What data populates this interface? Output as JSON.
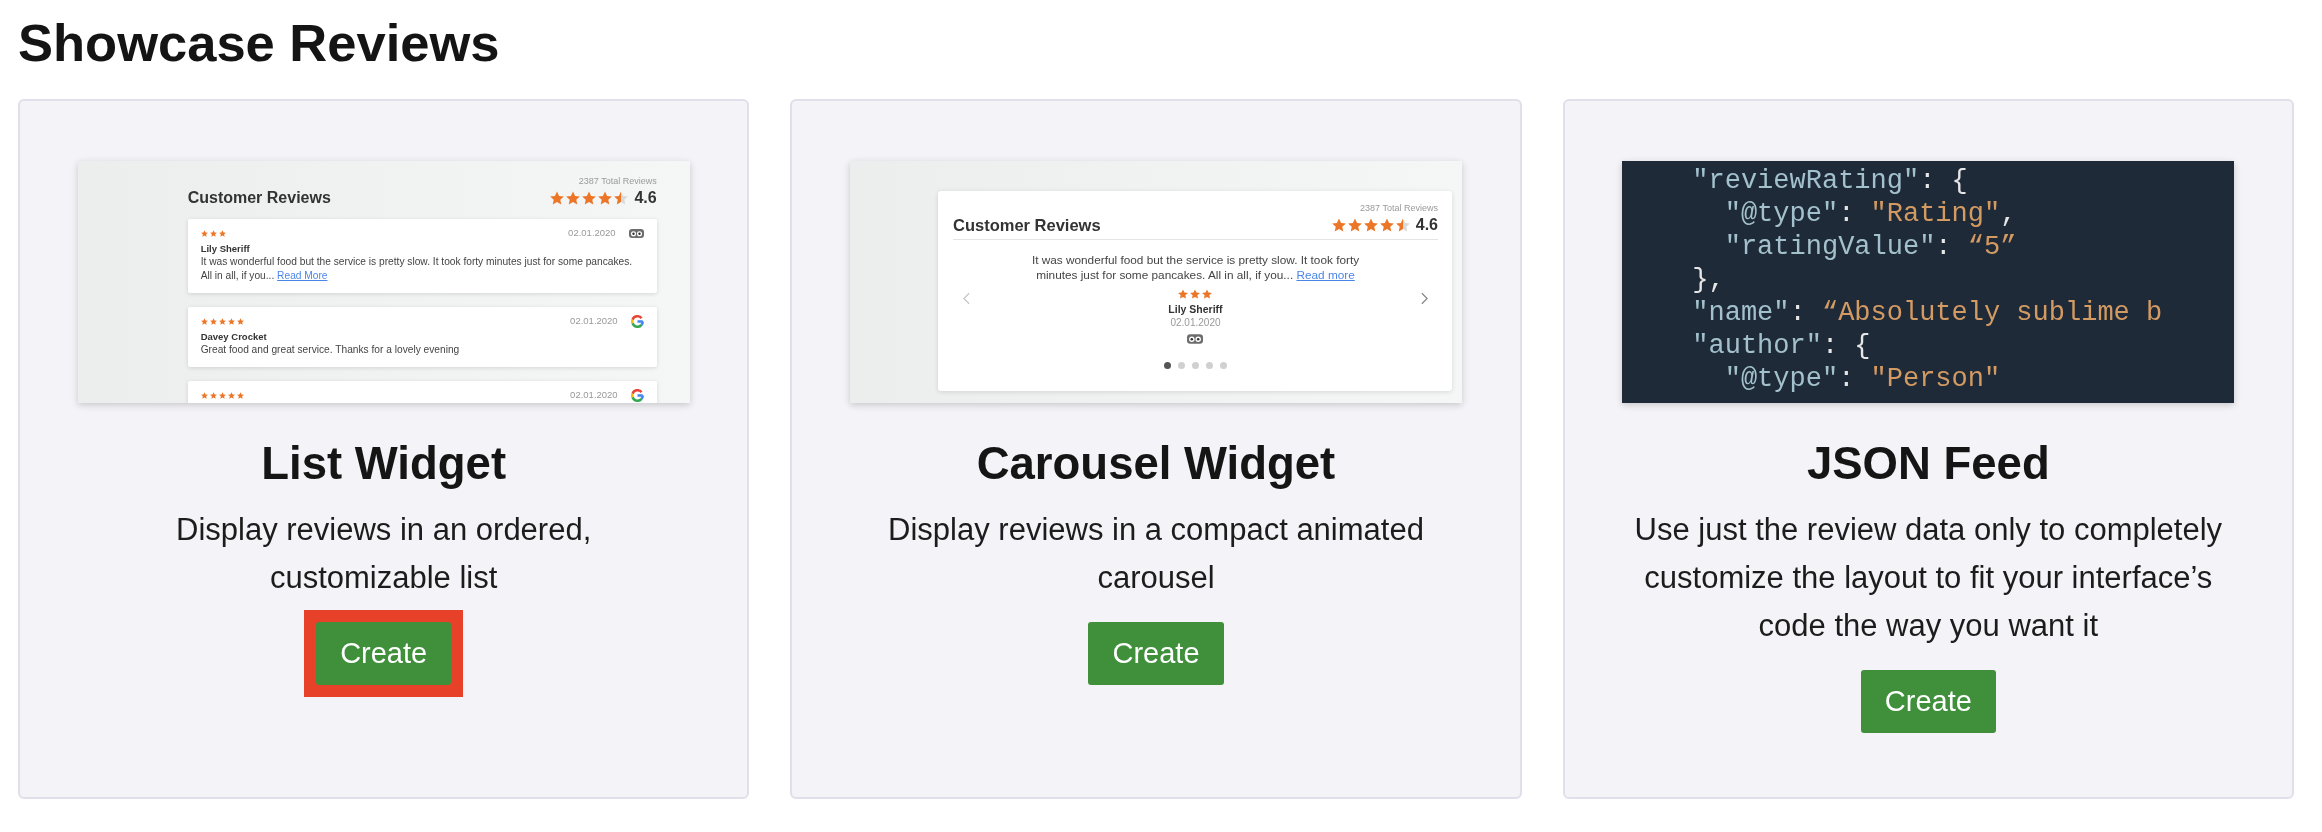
{
  "title": "Showcase Reviews",
  "cards": [
    {
      "kind": "list",
      "title": "List Widget",
      "description": "Display reviews in an ordered, customizable list",
      "button": "Create",
      "highlighted": true,
      "preview": {
        "total": "2387 Total Reviews",
        "heading": "Customer Reviews",
        "stars": 4.5,
        "score": "4.6",
        "reviews": [
          {
            "stars": 3,
            "date": "02.01.2020",
            "kind": "owl",
            "author": "Lily Sheriff",
            "text": "It was wonderful food but the service is pretty slow. It took forty minutes just for some pancakes. All in all, if you...",
            "link": "Read More"
          },
          {
            "stars": 5,
            "date": "02.01.2020",
            "kind": "google",
            "author": "Davey Crocket",
            "text": "Great food and great service. Thanks for a lovely evening"
          },
          {
            "stars": 5,
            "date": "02.01.2020",
            "kind": "google"
          }
        ]
      }
    },
    {
      "kind": "carousel",
      "title": "Carousel Widget",
      "description": "Display reviews in a compact animated carousel",
      "button": "Create",
      "highlighted": false,
      "preview": {
        "total": "2387 Total Reviews",
        "heading": "Customer Reviews",
        "stars": 4.5,
        "score": "4.6",
        "review": {
          "text": "It was wonderful food but the service is pretty slow. It took forty minutes just for some pancakes. All in all, if you...",
          "link": "Read more",
          "stars": 3,
          "author": "Lily Sheriff",
          "date": "02.01.2020",
          "kind": "owl"
        },
        "dots": [
          {
            "selected": true
          },
          {
            "selected": false
          },
          {
            "selected": false
          },
          {
            "selected": false
          },
          {
            "selected": false
          }
        ]
      }
    },
    {
      "kind": "code",
      "title": "JSON Feed",
      "description": "Use just the review data only to completely customize the layout to fit your interface’s code the way you want it",
      "button": "Create",
      "highlighted": false,
      "preview": {
        "lines": [
          [
            {
              "kind": "key",
              "text": "\"reviewRating\""
            },
            {
              "kind": "punct",
              "text": ": {"
            }
          ],
          [
            {
              "kind": "key",
              "text": "  \"@type\""
            },
            {
              "kind": "punct",
              "text": ": "
            },
            {
              "kind": "string",
              "text": "\"Rating\""
            },
            {
              "kind": "punct",
              "text": ","
            }
          ],
          [
            {
              "kind": "key",
              "text": "  \"ratingValue\""
            },
            {
              "kind": "punct",
              "text": ": "
            },
            {
              "kind": "string",
              "text": "“5”"
            }
          ],
          [
            {
              "kind": "punct",
              "text": "},"
            }
          ],
          [
            {
              "kind": "key",
              "text": "\"name\""
            },
            {
              "kind": "punct",
              "text": ": "
            },
            {
              "kind": "string",
              "text": "“Absolutely sublime b"
            }
          ],
          [
            {
              "kind": "key",
              "text": "\"author\""
            },
            {
              "kind": "punct",
              "text": ": {"
            }
          ],
          [
            {
              "kind": "key",
              "text": "  \"@type\""
            },
            {
              "kind": "punct",
              "text": ": "
            },
            {
              "kind": "string",
              "text": "\"Person\""
            }
          ]
        ]
      }
    }
  ]
}
